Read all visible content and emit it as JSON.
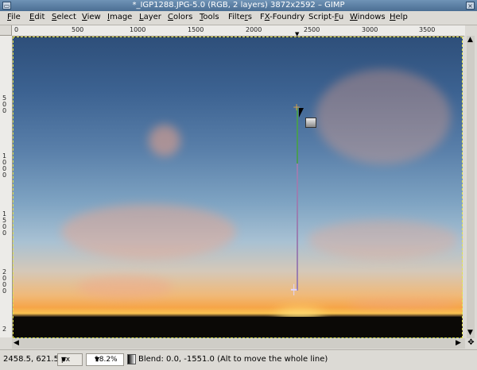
{
  "window": {
    "title": "*_IGP1288.JPG-5.0 (RGB, 2 layers) 3872x2592 – GIMP"
  },
  "menubar": {
    "items": [
      {
        "label": "File",
        "u": "F"
      },
      {
        "label": "Edit",
        "u": "E"
      },
      {
        "label": "Select",
        "u": "S"
      },
      {
        "label": "View",
        "u": "V"
      },
      {
        "label": "Image",
        "u": "I"
      },
      {
        "label": "Layer",
        "u": "L"
      },
      {
        "label": "Colors",
        "u": "C"
      },
      {
        "label": "Tools",
        "u": "T"
      },
      {
        "label": "Filters",
        "u": "r"
      },
      {
        "label": "FX-Foundry",
        "u": "X"
      },
      {
        "label": "Script-Fu",
        "u": "F"
      },
      {
        "label": "Windows",
        "u": "W"
      },
      {
        "label": "Help",
        "u": "H"
      }
    ]
  },
  "ruler": {
    "h_ticks": [
      "0",
      "500",
      "1000",
      "1500",
      "2000",
      "2500",
      "3000",
      "3500"
    ],
    "v_ticks": [
      "500",
      "1000",
      "1500",
      "2000",
      "2"
    ]
  },
  "status": {
    "coords": "2458.5, 621.5",
    "unit": "px",
    "zoom": "18.2%",
    "message": "Blend: 0.0, -1551.0 (Alt to move the whole line)"
  },
  "colors": {
    "titlebar": "#4b6e93",
    "sky_top": "#2e4f7a",
    "horizon": "#f6a548"
  }
}
